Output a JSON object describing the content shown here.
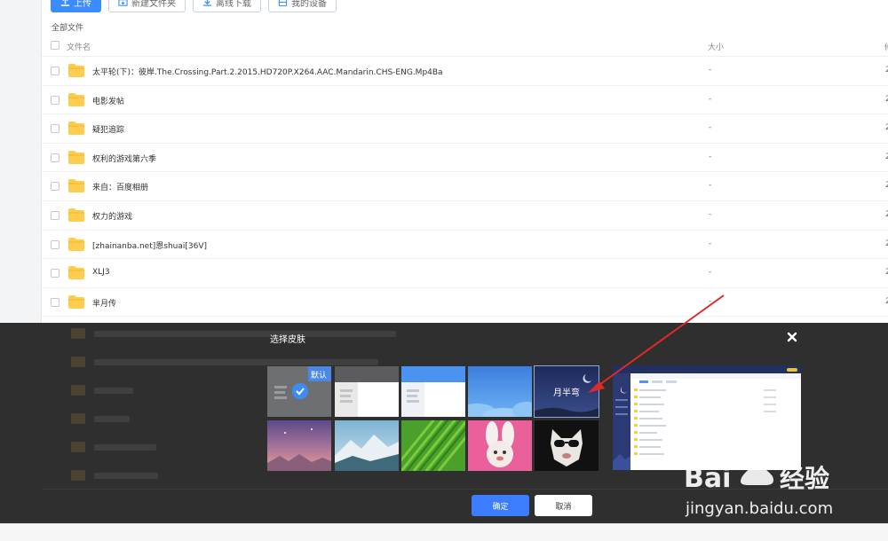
{
  "toolbar": {
    "upload_label": "上传",
    "new_folder_label": "新建文件夹",
    "offline_download_label": "离线下载",
    "my_devices_label": "我的设备"
  },
  "breadcrumb": "全部文件",
  "columns": {
    "name": "文件名",
    "size": "大小",
    "date_cut": "修"
  },
  "files": [
    {
      "name": "太平轮(下)：彼岸.The.Crossing.Part.2.2015.HD720P.X264.AAC.Mandarin.CHS-ENG.Mp4Ba",
      "size": "-",
      "date_cut": "2"
    },
    {
      "name": "电影发帖",
      "size": "-",
      "date_cut": "2"
    },
    {
      "name": "疑犯追踪",
      "size": "-",
      "date_cut": "2"
    },
    {
      "name": "权利的游戏第六季",
      "size": "-",
      "date_cut": "2"
    },
    {
      "name": "来自：百度相册",
      "size": "-",
      "date_cut": "2"
    },
    {
      "name": "权力的游戏",
      "size": "-",
      "date_cut": "2"
    },
    {
      "name": "[zhainanba.net]恩shuai[36V]",
      "size": "-",
      "date_cut": "2"
    },
    {
      "name": "XLJ3",
      "size": "-",
      "date_cut": "2"
    },
    {
      "name": "芈月传",
      "size": "-",
      "date_cut": "2"
    }
  ],
  "dialog": {
    "title": "选择皮肤",
    "default_badge": "默认",
    "moon_skin_label": "月半弯",
    "confirm_label": "确定",
    "cancel_label": "取消"
  },
  "skins": [
    {
      "name": "default-gray",
      "selected": true
    },
    {
      "name": "light-gray"
    },
    {
      "name": "light-blue"
    },
    {
      "name": "blue-sky"
    },
    {
      "name": "moon-night"
    },
    {
      "name": "purple-dusk"
    },
    {
      "name": "snow-mountain"
    },
    {
      "name": "green-leaf"
    },
    {
      "name": "pink-bunny"
    },
    {
      "name": "cool-dog"
    }
  ],
  "colors": {
    "primary": "#3c7dff",
    "annotation_arrow": "#e02a2a",
    "folder": "#ffcd4d"
  },
  "watermark": {
    "brand": "Bai百经验",
    "url": "jingyan.baidu.com"
  }
}
